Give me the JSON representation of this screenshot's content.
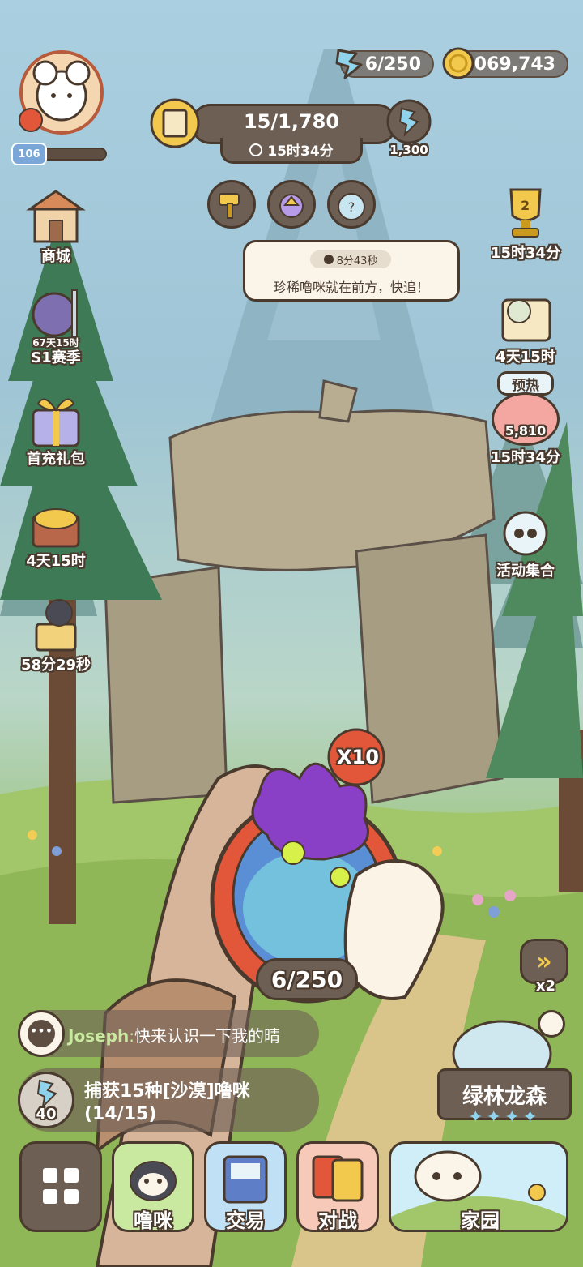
{
  "player": {
    "level": "106"
  },
  "resources": {
    "energy": "6/250",
    "coins": "3,069,743"
  },
  "quest": {
    "progress": "15/1,780",
    "timer": "15时34分",
    "energy_reward": "1,300"
  },
  "notice": {
    "timer": "8分43秒",
    "message": "珍稀噜咪就在前方，快追！"
  },
  "left_menu": [
    {
      "label": "商城"
    },
    {
      "label": "S1赛季",
      "sub": "67天15时"
    },
    {
      "label": "首充礼包"
    },
    {
      "label": "4天15时"
    },
    {
      "label": "58分29秒"
    }
  ],
  "right_menu": [
    {
      "label": "15时34分",
      "badge": "2"
    },
    {
      "label": "4天15时"
    },
    {
      "label": "15时34分",
      "badge_top": "预热",
      "value": "5,810"
    },
    {
      "label": "活动集合"
    }
  ],
  "capture": {
    "multiplier": "X10",
    "count": "6/250"
  },
  "speed": {
    "label": "x2"
  },
  "chat": {
    "name": "Joseph",
    "sep": ":",
    "message": "快来认识一下我的晴"
  },
  "mission": {
    "cost": "40",
    "title": "捕获15种[沙漠]噜咪",
    "progress": "(14/15)"
  },
  "location": {
    "name": "绿林龙森",
    "stars": "✦✦✦✦"
  },
  "nav": {
    "pets": "噜咪",
    "trade": "交易",
    "battle": "对战",
    "home": "家园"
  },
  "colors": {
    "panel_brown": "#6e5f55",
    "outline": "#4a3a2e",
    "pet_green": "#c9e8a0",
    "trade_blue": "#bfe0f5",
    "battle_pink": "#f7c9b8",
    "home_sky": "#cfeef7"
  }
}
